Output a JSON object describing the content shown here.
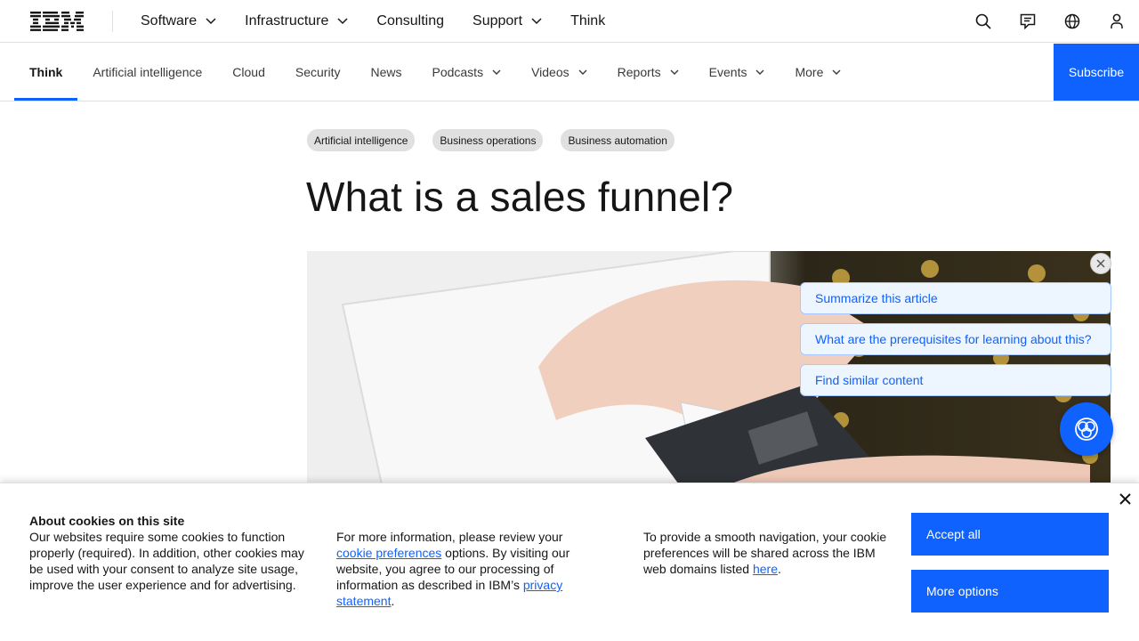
{
  "masthead": {
    "logo_alt": "IBM",
    "nav": [
      {
        "label": "Software",
        "dropdown": true
      },
      {
        "label": "Infrastructure",
        "dropdown": true
      },
      {
        "label": "Consulting",
        "dropdown": false
      },
      {
        "label": "Support",
        "dropdown": true
      },
      {
        "label": "Think",
        "dropdown": false
      }
    ],
    "utility_icons": [
      "search-icon",
      "chat-icon",
      "globe-icon",
      "user-icon"
    ]
  },
  "subnav": {
    "items": [
      {
        "label": "Think",
        "active": true
      },
      {
        "label": "Artificial intelligence"
      },
      {
        "label": "Cloud"
      },
      {
        "label": "Security"
      },
      {
        "label": "News"
      },
      {
        "label": "Podcasts",
        "dropdown": true
      },
      {
        "label": "Videos",
        "dropdown": true
      },
      {
        "label": "Reports",
        "dropdown": true
      },
      {
        "label": "Events",
        "dropdown": true
      },
      {
        "label": "More",
        "dropdown": true
      }
    ],
    "subscribe_label": "Subscribe"
  },
  "article": {
    "tags": [
      "Artificial intelligence",
      "Business operations",
      "Business automation"
    ],
    "title": "What is a sales funnel?"
  },
  "ai_panel": {
    "suggestions": [
      "Summarize this article",
      "What are the prerequisites for learning about this?",
      "Find similar content"
    ]
  },
  "cookie_banner": {
    "heading": "About cookies on this site",
    "col1_text": "Our websites require some cookies to function properly (required). In addition, other cookies may be used with your consent to analyze site usage, improve the user experience and for advertising.",
    "col2_pre": "For more information, please review your ",
    "col2_link1": "cookie preferences",
    "col2_mid": " options. By visiting our website, you agree to our processing of information as described in IBM’s ",
    "col2_link2": "privacy statement",
    "col2_post": ".",
    "col3_pre": "To provide a smooth navigation, your cookie preferences will be shared across the IBM web domains listed ",
    "col3_link": "here",
    "col3_post": ".",
    "accept_label": "Accept all",
    "more_label": "More options"
  },
  "colors": {
    "accent": "#0f62fe",
    "text": "#161616",
    "tag_bg": "#e0e0e0"
  }
}
